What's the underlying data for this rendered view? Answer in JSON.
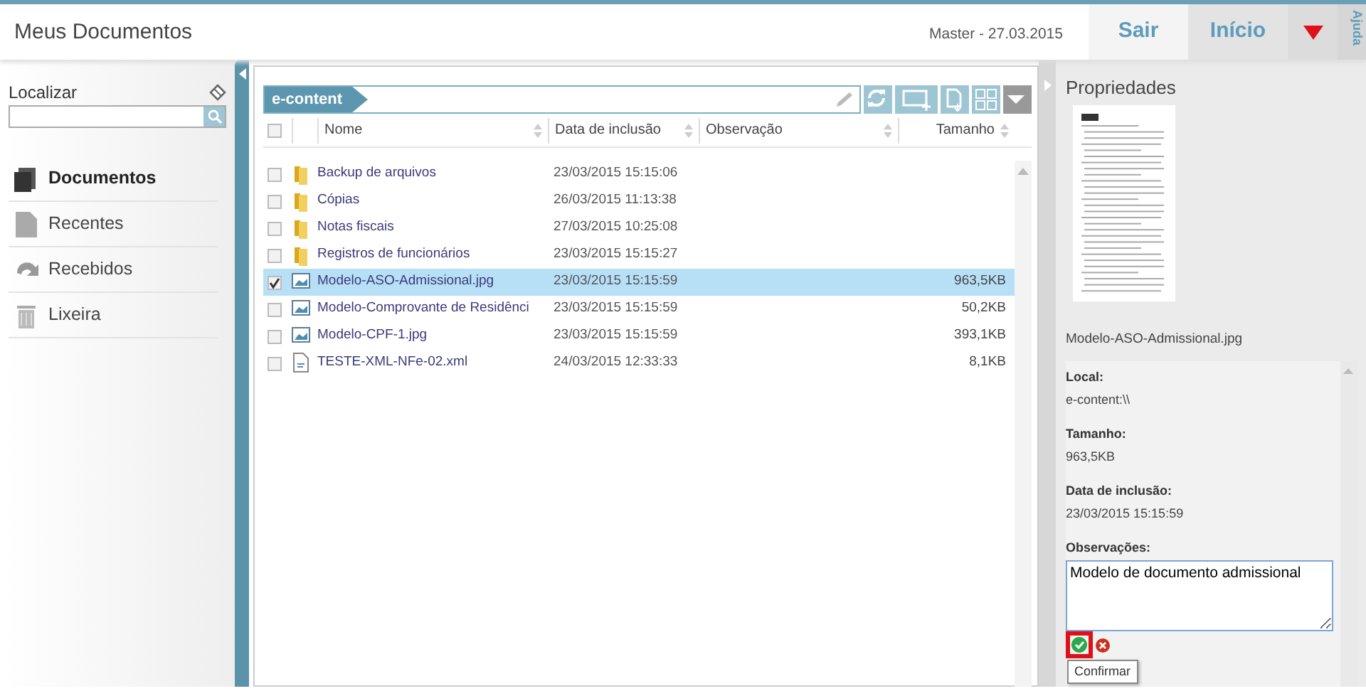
{
  "header": {
    "title": "Meus Documentos",
    "user_date": "Master  -  27.03.2015",
    "buttons": [
      {
        "label": "Sair",
        "selected": false
      },
      {
        "label": "Início",
        "selected": true
      }
    ],
    "help": "Ajuda"
  },
  "sidebar": {
    "search_label": "Localizar",
    "items": [
      {
        "label": "Documentos",
        "kind": "documents",
        "selected": true
      },
      {
        "label": "Recentes",
        "kind": "recent",
        "selected": false
      },
      {
        "label": "Recebidos",
        "kind": "received",
        "selected": false
      },
      {
        "label": "Lixeira",
        "kind": "trash",
        "selected": false
      }
    ]
  },
  "browser": {
    "breadcrumb": "e-content",
    "select_all_checked": false,
    "columns": [
      "Nome",
      "Data de inclusão",
      "Observação",
      "Tamanho"
    ],
    "rows": [
      {
        "kind": "folder",
        "name": "Backup de arquivos",
        "date": "23/03/2015 15:15:06",
        "size": "",
        "selected": false,
        "checked": false
      },
      {
        "kind": "folder",
        "name": "Cópias",
        "date": "26/03/2015 11:13:38",
        "size": "",
        "selected": false,
        "checked": false
      },
      {
        "kind": "folder",
        "name": "Notas fiscais",
        "date": "27/03/2015 10:25:08",
        "size": "",
        "selected": false,
        "checked": false
      },
      {
        "kind": "folder",
        "name": "Registros de funcionários",
        "date": "23/03/2015 15:15:27",
        "size": "",
        "selected": false,
        "checked": false
      },
      {
        "kind": "image",
        "name": "Modelo-ASO-Admissional.jpg",
        "date": "23/03/2015 15:15:59",
        "size": "963,5KB",
        "selected": true,
        "checked": true
      },
      {
        "kind": "image",
        "name": "Modelo-Comprovante de Residênci",
        "date": "23/03/2015 15:15:59",
        "size": "50,2KB",
        "selected": false,
        "checked": false
      },
      {
        "kind": "image",
        "name": "Modelo-CPF-1.jpg",
        "date": "23/03/2015 15:15:59",
        "size": "393,1KB",
        "selected": false,
        "checked": false
      },
      {
        "kind": "xml",
        "name": "TESTE-XML-NFe-02.xml",
        "date": "24/03/2015 12:33:33",
        "size": "8,1KB",
        "selected": false,
        "checked": false
      }
    ]
  },
  "properties": {
    "title": "Propriedades",
    "file_name": "Modelo-ASO-Admissional.jpg",
    "fields": [
      {
        "label": "Local:",
        "value": "e-content:\\\\"
      },
      {
        "label": "Tamanho:",
        "value": "963,5KB"
      },
      {
        "label": "Data de inclusão:",
        "value": "23/03/2015 15:15:59"
      }
    ],
    "notes_label": "Observações:",
    "notes_value": "Modelo de documento admissional",
    "confirm_highlighted": true,
    "tooltip": "Confirmar"
  }
}
